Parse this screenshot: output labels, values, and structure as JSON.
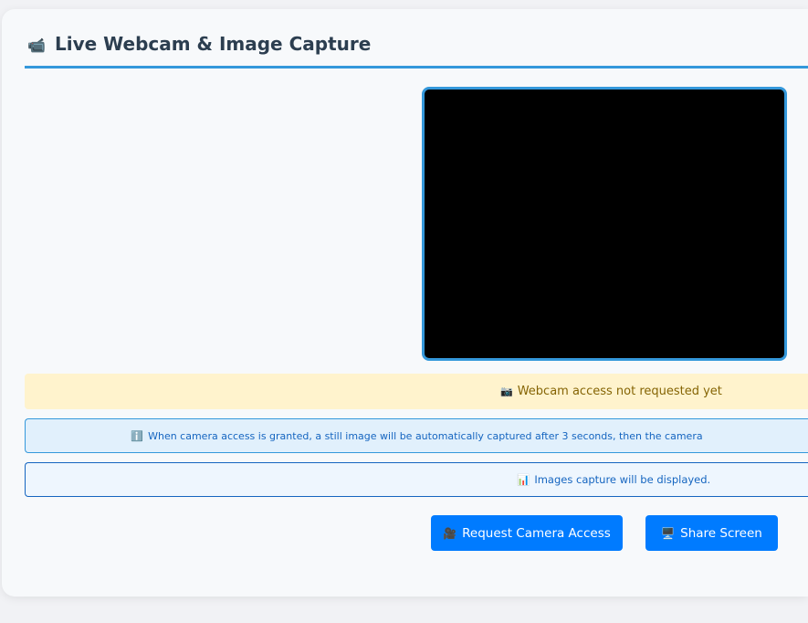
{
  "header": {
    "icon": "video-camera-icon",
    "icon_glyph": "📹",
    "title": "Live Webcam & Image Capture"
  },
  "status": {
    "icon_glyph": "📷",
    "text": "Webcam access not requested yet"
  },
  "info": {
    "icon_glyph": "ℹ️",
    "text": "When camera access is granted, a still image will be automatically captured after 3 seconds, then the camera"
  },
  "images": {
    "icon_glyph": "📊",
    "text": "Images capture will be displayed."
  },
  "buttons": {
    "request": {
      "icon_glyph": "🎥",
      "label": "Request Camera Access"
    },
    "share": {
      "icon_glyph": "🖥️",
      "label": "Share Screen"
    }
  },
  "colors": {
    "accent": "#3498db",
    "button": "#007bff",
    "warning_bg": "#fff3cd",
    "warning_text": "#856404"
  }
}
